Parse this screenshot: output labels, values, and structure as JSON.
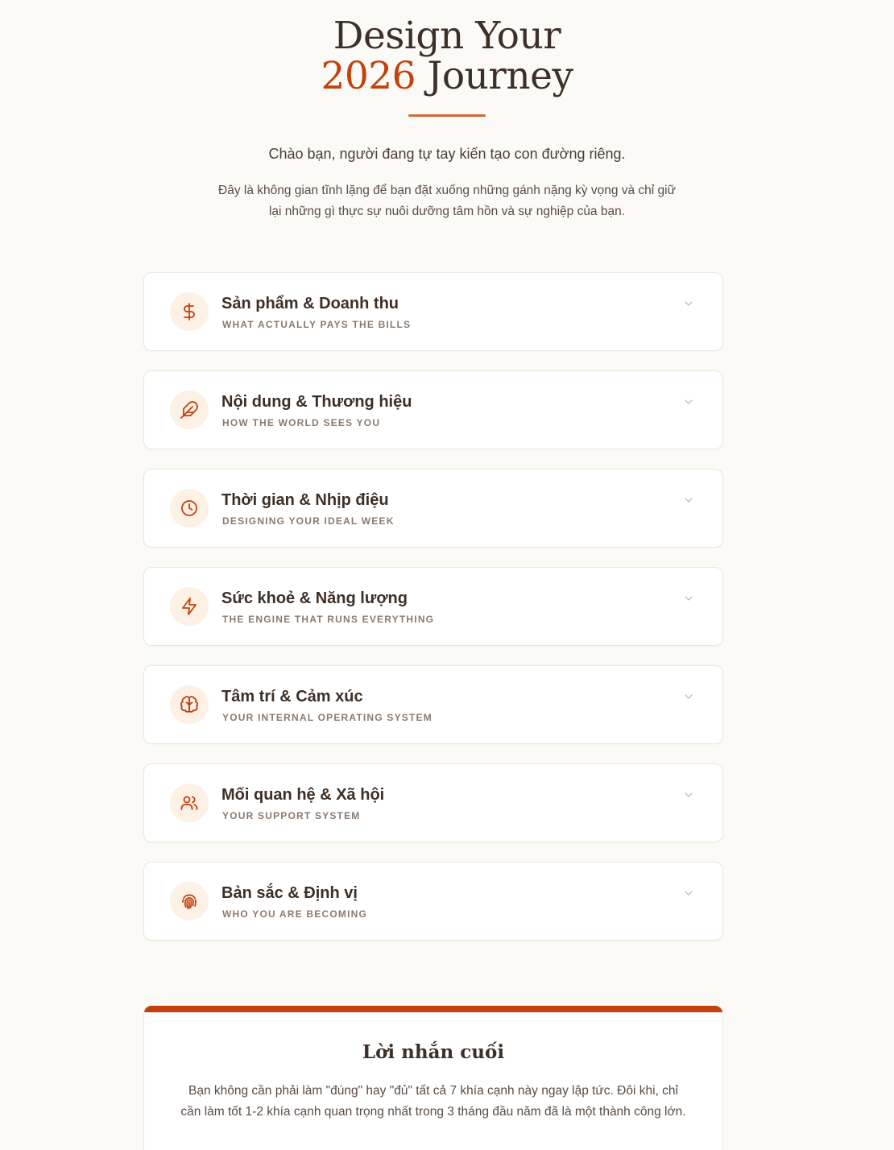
{
  "hero": {
    "title_line1": "Design Your",
    "title_year": "2026",
    "title_line2_rest": " Journey",
    "greeting": "Chào bạn, người đang tự tay kiến tạo con đường riêng.",
    "intro": "Đây là không gian tĩnh lặng để bạn đặt xuống những gánh nặng kỳ vọng và chỉ giữ lại những gì thực sự nuôi dưỡng tâm hồn và sự nghiệp của bạn."
  },
  "sections": [
    {
      "title": "Sản phẩm & Doanh thu",
      "subtitle": "WHAT ACTUALLY PAYS THE BILLS",
      "icon": "dollar-icon"
    },
    {
      "title": "Nội dung & Thương hiệu",
      "subtitle": "HOW THE WORLD SEES YOU",
      "icon": "feather-icon"
    },
    {
      "title": "Thời gian & Nhịp điệu",
      "subtitle": "DESIGNING YOUR IDEAL WEEK",
      "icon": "clock-icon"
    },
    {
      "title": "Sức khoẻ & Năng lượng",
      "subtitle": "THE ENGINE THAT RUNS EVERYTHING",
      "icon": "lightning-icon"
    },
    {
      "title": "Tâm trí & Cảm xúc",
      "subtitle": "YOUR INTERNAL OPERATING SYSTEM",
      "icon": "brain-icon"
    },
    {
      "title": "Mối quan hệ & Xã hội",
      "subtitle": "YOUR SUPPORT SYSTEM",
      "icon": "users-icon"
    },
    {
      "title": "Bản sắc & Định vị",
      "subtitle": "WHO YOU ARE BECOMING",
      "icon": "fingerprint-icon"
    }
  ],
  "final": {
    "title": "Lời nhắn cuối",
    "text": "Bạn không cần phải làm \"đúng\" hay \"đủ\" tất cả 7 khía cạnh này ngay lập tức. Đôi khi, chỉ cần làm tốt 1-2 khía cạnh quan trọng nhất trong 3 tháng đầu năm đã là một thành công lớn."
  },
  "colors": {
    "accent": "#c2410c",
    "background": "#fcfaf7",
    "icon_bg": "#fdf0e5",
    "text": "#3d2f26"
  }
}
